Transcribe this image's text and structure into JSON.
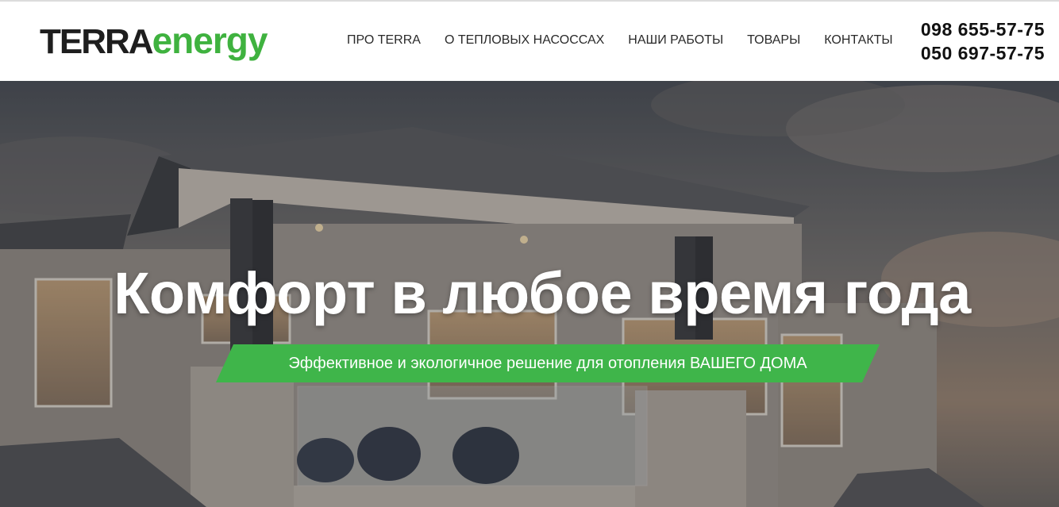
{
  "logo": {
    "part1": "TERRA",
    "part2": "energy"
  },
  "nav": {
    "items": [
      {
        "label": "ПРО TERRA"
      },
      {
        "label": "О ТЕПЛОВЫХ НАСОССАХ"
      },
      {
        "label": "НАШИ РАБОТЫ"
      },
      {
        "label": "ТОВАРЫ"
      },
      {
        "label": "КОНТАКТЫ"
      }
    ]
  },
  "contacts": {
    "phone1": "098 655-57-75",
    "phone2": "050 697-57-75"
  },
  "hero": {
    "title": "Комфорт в любое время года",
    "subtitle": "Эффективное и экологичное решение для отопления ВАШЕГО ДОМА"
  },
  "colors": {
    "brand_green": "#3fb54a",
    "logo_dark": "#1e1e1e",
    "nav_text": "#2a2a2a"
  }
}
